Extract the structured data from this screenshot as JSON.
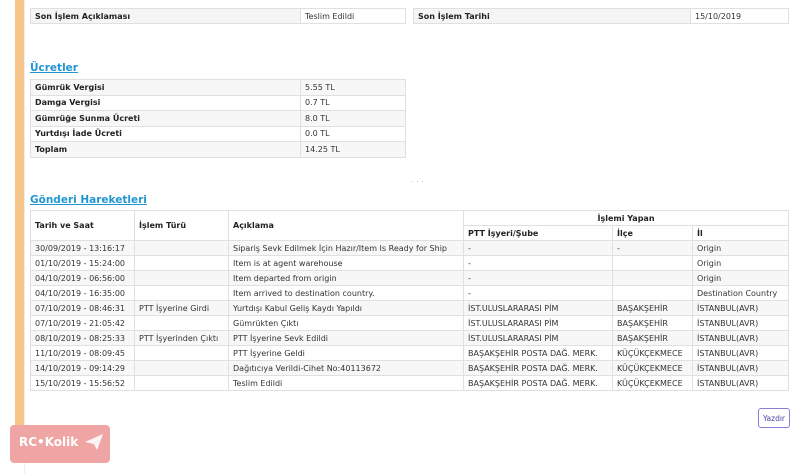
{
  "summary": {
    "last_desc_label": "Son İşlem Açıklaması",
    "last_desc_value": "Teslim Edildi",
    "last_date_label": "Son İşlem Tarihi",
    "last_date_value": "15/10/2019"
  },
  "fees": {
    "title": "Ücretler",
    "rows": [
      {
        "label": "Gümrük Vergisi",
        "value": "5.55 TL"
      },
      {
        "label": "Damga Vergisi",
        "value": "0.7 TL"
      },
      {
        "label": "Gümrüğe Sunma Ücreti",
        "value": "8.0 TL"
      },
      {
        "label": "Yurtdışı İade Ücreti",
        "value": "0.0 TL"
      },
      {
        "label": "Toplam",
        "value": "14.25 TL"
      }
    ]
  },
  "moves": {
    "title": "Gönderi Hareketleri",
    "headers": {
      "date": "Tarih ve Saat",
      "type": "İşlem Türü",
      "desc": "Açıklama",
      "by": "İşlemi Yapan",
      "branch": "PTT İşyeri/Şube",
      "district": "İlçe",
      "city": "İl"
    },
    "rows": [
      {
        "date": "30/09/2019 - 13:16:17",
        "type": "",
        "desc": "Sipariş Sevk Edilmek İçin Hazır/Item Is Ready for Ship",
        "branch": "-",
        "district": "-",
        "city": "Origin"
      },
      {
        "date": "01/10/2019 - 15:24:00",
        "type": "",
        "desc": "Item is at agent warehouse",
        "branch": "-",
        "district": "",
        "city": "Origin"
      },
      {
        "date": "04/10/2019 - 06:56:00",
        "type": "",
        "desc": "Item departed from origin",
        "branch": "-",
        "district": "",
        "city": "Origin"
      },
      {
        "date": "04/10/2019 - 16:35:00",
        "type": "",
        "desc": "Item arrived to destination country.",
        "branch": "-",
        "district": "",
        "city": "Destination Country"
      },
      {
        "date": "07/10/2019 - 08:46:31",
        "type": "PTT İşyerine Girdi",
        "desc": "Yurtdışı Kabul Geliş Kaydı Yapıldı",
        "branch": "İST.ULUSLARARASI PİM",
        "district": "BAŞAKŞEHİR",
        "city": "İSTANBUL(AVR)"
      },
      {
        "date": "07/10/2019 - 21:05:42",
        "type": "",
        "desc": "Gümrükten Çıktı",
        "branch": "İST.ULUSLARARASI PİM",
        "district": "BAŞAKŞEHİR",
        "city": "İSTANBUL(AVR)"
      },
      {
        "date": "08/10/2019 - 08:25:33",
        "type": "PTT İşyerinden Çıktı",
        "desc": "PTT İşyerine Sevk Edildi",
        "branch": "İST.ULUSLARARASI PİM",
        "district": "BAŞAKŞEHİR",
        "city": "İSTANBUL(AVR)"
      },
      {
        "date": "11/10/2019 - 08:09:45",
        "type": "",
        "desc": "PTT İşyerine Geldi",
        "branch": "BAŞAKŞEHİR POSTA DAĞ. MERK.",
        "district": "KÜÇÜKÇEKMECE",
        "city": "İSTANBUL(AVR)"
      },
      {
        "date": "14/10/2019 - 09:14:29",
        "type": "",
        "desc": "Dağıtıcıya Verildi-Cihet No:40113672",
        "branch": "BAŞAKŞEHİR POSTA DAĞ. MERK.",
        "district": "KÜÇÜKÇEKMECE",
        "city": "İSTANBUL(AVR)"
      },
      {
        "date": "15/10/2019 - 15:56:52",
        "type": "",
        "desc": "Teslim Edildi",
        "branch": "BAŞAKŞEHİR POSTA DAĞ. MERK.",
        "district": "KÜÇÜKÇEKMECE",
        "city": "İSTANBUL(AVR)"
      }
    ]
  },
  "print_label": "Yazdır",
  "logo_text": "RC•Kolik",
  "colors": {
    "accent": "#2196d3",
    "left_bar": "#f6c58a",
    "logo_bg": "#f0a5a5",
    "button_border": "#8a7fd8"
  }
}
